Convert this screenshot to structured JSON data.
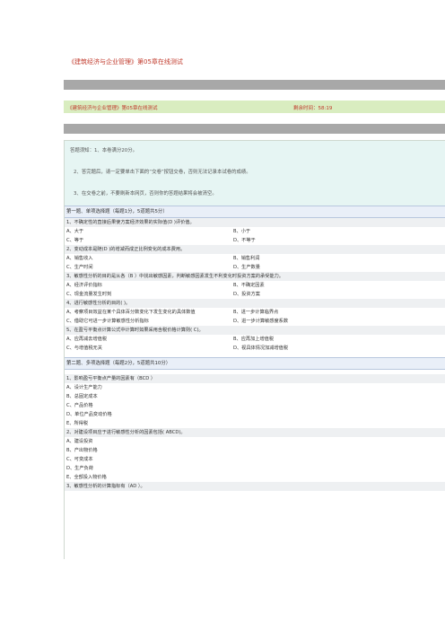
{
  "page_title": "《建筑经济与企业管理》第05章在线测试",
  "subheader": {
    "title": "《建筑经济与企业管理》第05章在线测试",
    "timer": "剩余时间：58:19"
  },
  "notice": {
    "line1": "答题须知：1、本卷满分20分。",
    "line2": "2、答完题后，请一定要单击下面的“交卷”按钮交卷，否则无法记录本试卷的成绩。",
    "line3": "3、在交卷之前，不要刷新本网页，否则你的答题结果将会被清空。"
  },
  "section1": {
    "heading": "第一题、单项选择题（每题1分，5道题共5分）",
    "questions": [
      {
        "q": "1、不确定性的直接后果使方案经济效果的实际值(D )评价值。",
        "a": "A、大于",
        "b": "B、小于",
        "c": "C、等于",
        "d": "D、不等于"
      },
      {
        "q": "2、变动成本是随(D )的增减而成正比例变化的成本费用。",
        "a": "A、销售收入",
        "b": "B、销售利润",
        "c": "C、生产时间",
        "d": "D、生产数量"
      },
      {
        "q": "3、敏感性分析的目的是从各（B ）中找出敏感因素，判断敏感因素发生不利变化时投资方案的承受能力。",
        "a": "A、经济评价指标",
        "b": "B、不确定因素",
        "c": "C、现金流量发生时刻",
        "d": "D、投资方案"
      },
      {
        "q": "4、进行敏感性分析的目的( )。",
        "a": "A、考察项目效益在某个具体百分数变化下发生变化的具体数值",
        "b": "B、进一步计算临界点",
        "c": "C、借助它可进一步计算敏感性分析指标",
        "d": "D、进一步计算敏感度系数"
      },
      {
        "q": "5、在盈亏平衡点计算公式中计算时如果采用含税价格计算则( C)。",
        "a": "A、应再减去增值税",
        "b": "B、应再加上增值税",
        "c": "C、与增值税无关",
        "d": "D、视具体情况加减增值税"
      }
    ]
  },
  "section2": {
    "heading": "第二题、多项选择题（每题2分，5道题共10分）",
    "questions": [
      {
        "q": "1、影响盈亏平衡点产量的因素有（BCD ）",
        "options": [
          "A、设计生产能力",
          "B、总固定成本",
          "C、产品价格",
          "D、单位产品变动价格",
          "E、所得税"
        ]
      },
      {
        "q": "2、对建设项目应于进行敏感性分析的因素包括( ABCD)。",
        "options": [
          "A、建设投资",
          "B、产出物价格",
          "C、可变成本",
          "D、生产负荷",
          "E、全部投入物价格"
        ]
      },
      {
        "q": "3、敏感性分析的计算指标有（AD ）。",
        "options": []
      }
    ]
  }
}
